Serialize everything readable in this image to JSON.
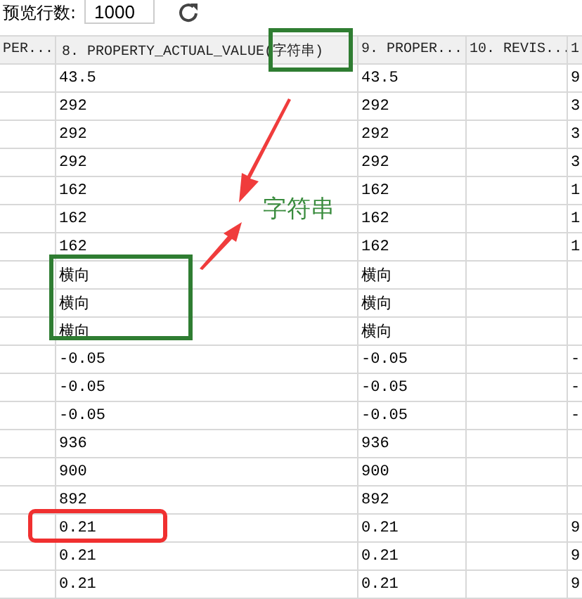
{
  "toolbar": {
    "label": "预览行数:",
    "row_count": "1000"
  },
  "table": {
    "columns": [
      "PER...",
      "8. PROPERTY_ACTUAL_VALUE(字符串)",
      "9. PROPER...",
      "10. REVIS...",
      "1"
    ],
    "rows": [
      {
        "value_8": "43.5",
        "value_9": "43.5",
        "value_11": "9"
      },
      {
        "value_8": "292",
        "value_9": "292",
        "value_11": "3"
      },
      {
        "value_8": "292",
        "value_9": "292",
        "value_11": "3"
      },
      {
        "value_8": "292",
        "value_9": "292",
        "value_11": "3"
      },
      {
        "value_8": "162",
        "value_9": "162",
        "value_11": "1"
      },
      {
        "value_8": "162",
        "value_9": "162",
        "value_11": "1"
      },
      {
        "value_8": "162",
        "value_9": "162",
        "value_11": "1"
      },
      {
        "value_8": "横向",
        "value_9": "横向"
      },
      {
        "value_8": "横向",
        "value_9": "横向"
      },
      {
        "value_8": "横向",
        "value_9": "横向"
      },
      {
        "value_8": "-0.05",
        "value_9": "-0.05",
        "value_11": "-"
      },
      {
        "value_8": "-0.05",
        "value_9": "-0.05",
        "value_11": "-"
      },
      {
        "value_8": "-0.05",
        "value_9": "-0.05",
        "value_11": "-"
      },
      {
        "value_8": "936",
        "value_9": "936"
      },
      {
        "value_8": "900",
        "value_9": "900"
      },
      {
        "value_8": "892",
        "value_9": "892"
      },
      {
        "value_8": "0.21",
        "value_9": "0.21",
        "value_11": "9"
      },
      {
        "value_8": "0.21",
        "value_9": "0.21",
        "value_11": "9"
      },
      {
        "value_8": "0.21",
        "value_9": "0.21",
        "value_11": "9"
      }
    ]
  },
  "annotation": {
    "label": "字符串"
  }
}
